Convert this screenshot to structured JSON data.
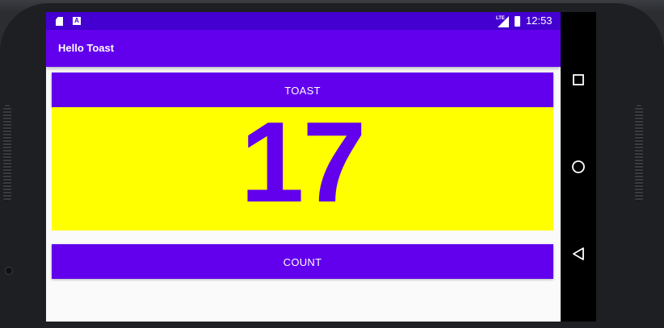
{
  "status_bar": {
    "time": "12:53",
    "notification_icons": [
      "sd-card-icon",
      "a-icon"
    ],
    "a_icon_text": "A",
    "network_label": "LTE"
  },
  "app_bar": {
    "title": "Hello Toast"
  },
  "main": {
    "toast_button_label": "TOAST",
    "count_value": "17",
    "count_button_label": "COUNT"
  },
  "navigation": {
    "items": [
      "recent-apps",
      "home",
      "back"
    ]
  },
  "colors": {
    "status_bar": "#4400d1",
    "primary": "#6200ee",
    "count_background": "#ffff00",
    "screen_background": "#fafafa",
    "nav_bar": "#000000"
  }
}
